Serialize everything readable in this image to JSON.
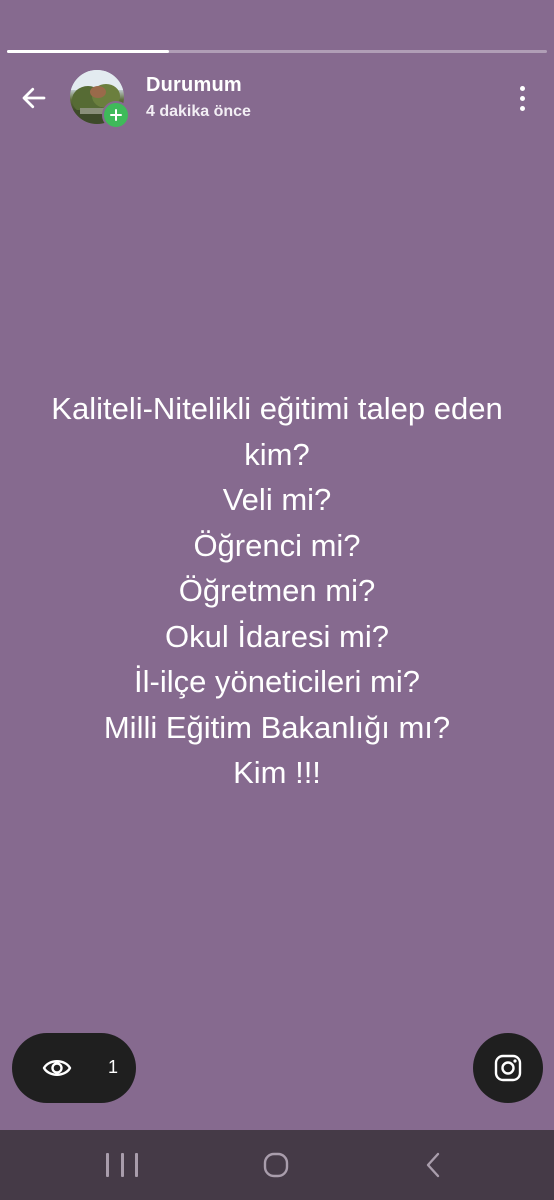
{
  "story": {
    "progress": 0.3,
    "title": "Durumum",
    "subtitle": "4 dakika önce",
    "background_color": "#866a8f"
  },
  "header": {
    "back_icon": "arrow-left-icon",
    "menu_icon": "more-vert-icon",
    "avatar_badge_icon": "plus-icon"
  },
  "status_lines": [
    "Kaliteli-Nitelikli eğitimi talep eden",
    "kim?",
    "Veli mi?",
    "Öğrenci mi?",
    "Öğretmen mi?",
    "Okul İdaresi mi?",
    "İl-ilçe yöneticileri mi?",
    "Milli Eğitim Bakanlığı mı?",
    "Kim !!!"
  ],
  "footer": {
    "views_icon": "eye-icon",
    "views_count": "1",
    "share_icon": "instagram-icon"
  },
  "system_nav": {
    "recents_icon": "recents-icon",
    "home_icon": "home-icon",
    "back_icon": "back-chevron-icon"
  }
}
